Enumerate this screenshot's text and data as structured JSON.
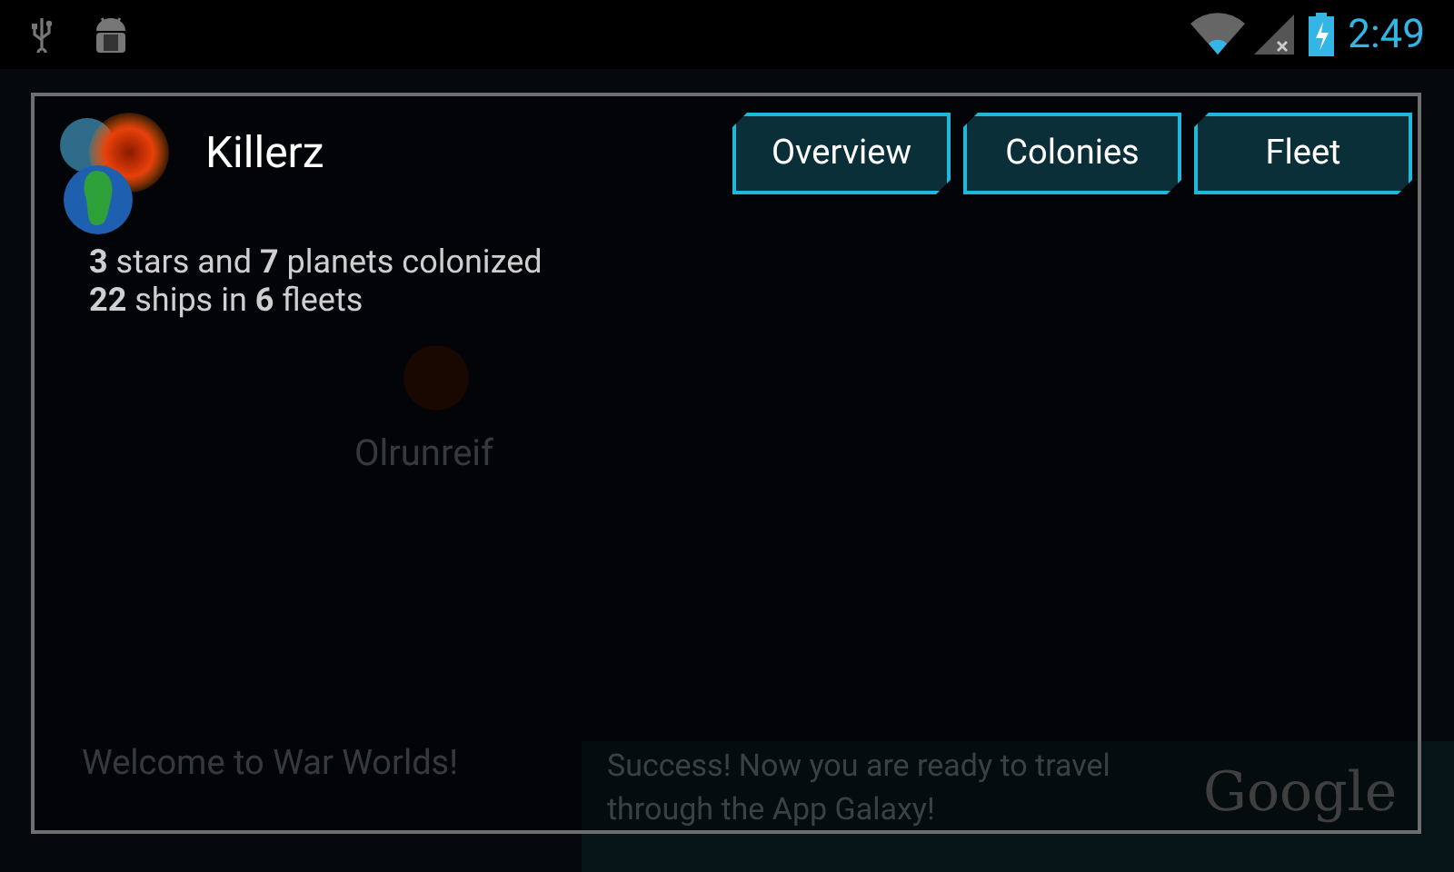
{
  "status_bar": {
    "time": "2:49"
  },
  "background": {
    "star_name": "Olrunreif",
    "welcome": "Welcome to War Worlds!",
    "ad_text": "Success! Now you are ready to travel through the App Galaxy!",
    "ad_brand": "Google"
  },
  "dialog": {
    "title": "Killerz",
    "stats": [
      "**3** stars and **7** planets colonized",
      "**22** ships in **6** fleets"
    ],
    "buttons": [
      "Overview",
      "Colonies",
      "Fleet"
    ]
  }
}
